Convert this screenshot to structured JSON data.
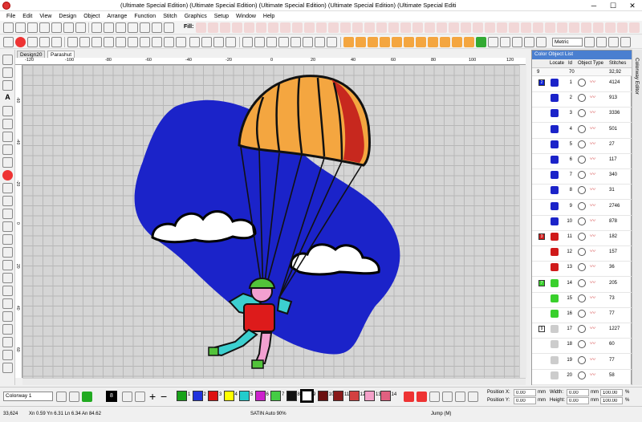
{
  "window": {
    "title": "(Ultimate Special Edition) (Ultimate Special Edition) (Ultimate Special Edition) (Ultimate Special Edition) (Ultimate Special Editi"
  },
  "menu": [
    "File",
    "Edit",
    "View",
    "Design",
    "Object",
    "Arrange",
    "Function",
    "Stitch",
    "Graphics",
    "Setup",
    "Window",
    "Help"
  ],
  "toolbar": {
    "fill_label": "Fill:",
    "metric_value": "Metric"
  },
  "tabs": [
    "Design20",
    "Parashut"
  ],
  "hruler": [
    "-120",
    "-100",
    "-80",
    "-60",
    "-40",
    "-20",
    "0",
    "20",
    "40",
    "60",
    "80",
    "100",
    "120"
  ],
  "vruler": [
    "-60",
    "-40",
    "-20",
    "0",
    "20",
    "40",
    "60"
  ],
  "panel": {
    "title": "Color Object List",
    "headers": {
      "locate": "Locate",
      "id": "Id",
      "object_type": "Object Type",
      "stitches": "Stitches"
    },
    "totals": {
      "a": "9",
      "b": "70",
      "c": "32,92"
    },
    "rows": [
      {
        "id": "1",
        "st": "4124"
      },
      {
        "id": "2",
        "st": "913"
      },
      {
        "id": "3",
        "st": "3336"
      },
      {
        "id": "4",
        "st": "501"
      },
      {
        "id": "5",
        "st": "27"
      },
      {
        "id": "6",
        "st": "117"
      },
      {
        "id": "7",
        "st": "340"
      },
      {
        "id": "8",
        "st": "31"
      },
      {
        "id": "9",
        "st": "2746"
      },
      {
        "id": "10",
        "st": "878"
      },
      {
        "id": "11",
        "st": "182"
      },
      {
        "id": "12",
        "st": "157"
      },
      {
        "id": "13",
        "st": "36"
      },
      {
        "id": "14",
        "st": "205"
      },
      {
        "id": "15",
        "st": "73"
      },
      {
        "id": "16",
        "st": "77"
      },
      {
        "id": "17",
        "st": "1227"
      },
      {
        "id": "18",
        "st": "60"
      },
      {
        "id": "19",
        "st": "77"
      },
      {
        "id": "20",
        "st": "58"
      }
    ],
    "groups": [
      {
        "label": "2",
        "color": "#0a1fd6",
        "row": 0
      },
      {
        "label": "3",
        "color": "#d01a1a",
        "row": 10
      },
      {
        "label": "7",
        "color": "#39d02c",
        "row": 13
      },
      {
        "label": "9",
        "color": "#ffffff",
        "row": 16
      }
    ]
  },
  "side_tab": "Colorway Editor",
  "bottom": {
    "colorway": "Colorway 1",
    "needle_label": "8",
    "palette": [
      {
        "n": "1",
        "c": "#1aa31a"
      },
      {
        "n": "2",
        "c": "#2233dd"
      },
      {
        "n": "3",
        "c": "#dd1111"
      },
      {
        "n": "4",
        "c": "#ffff00"
      },
      {
        "n": "5",
        "c": "#22cccc"
      },
      {
        "n": "6",
        "c": "#cc22cc"
      },
      {
        "n": "7",
        "c": "#44cc44"
      },
      {
        "n": "8",
        "c": "#111111"
      },
      {
        "n": "9",
        "c": "#ffffff"
      },
      {
        "n": "10",
        "c": "#6b1010"
      },
      {
        "n": "11",
        "c": "#8a1a1a"
      },
      {
        "n": "12",
        "c": "#d24040"
      },
      {
        "n": "13",
        "c": "#f4a0c8"
      },
      {
        "n": "14",
        "c": "#e06080"
      }
    ],
    "posx_label": "Position X:",
    "posx": "0.00",
    "posy_label": "Position Y:",
    "posy": "0.00",
    "mm": "mm",
    "width_label": "Width:",
    "width": "0.00",
    "height_label": "Height:",
    "height": "0.00",
    "pct1": "100.00",
    "pct2": "100.00",
    "pct_unit": "%"
  },
  "status": {
    "stitch_count": "33,624",
    "coords": "Xn 0.59 Yn 6.31 Ln 6.34 An 84.62",
    "stitch_type": "SATIN Auto 90%",
    "jump": "Jump (M)"
  },
  "colors": {
    "accent": "#4a7fd0",
    "sky": "#1b23c9",
    "canopy_orange": "#f4a640",
    "canopy_red": "#c7281e"
  }
}
